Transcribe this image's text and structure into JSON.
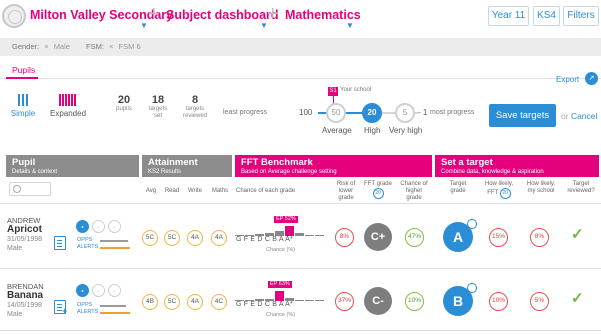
{
  "breadcrumb": [
    {
      "label": "Milton Valley Secondary"
    },
    {
      "label": "Subject dashboard"
    },
    {
      "label": "Mathematics"
    }
  ],
  "top_buttons": [
    "Year 11",
    "KS4",
    "Filters"
  ],
  "filters": [
    {
      "label": "Gender:",
      "value": "Male"
    },
    {
      "label": "FSM:",
      "value": "FSM 6"
    }
  ],
  "tabs": [
    {
      "label": "Pupils"
    }
  ],
  "export_label": "Export",
  "view_options": [
    {
      "label": "Simple",
      "active": true
    },
    {
      "label": "Expanded",
      "active": false
    }
  ],
  "stats": [
    {
      "value": "20",
      "label": "pupils"
    },
    {
      "value": "18",
      "label": "targets set"
    },
    {
      "value": "8",
      "label": "targets reviewed"
    }
  ],
  "slider": {
    "least_label": "least progress",
    "most_label": "most progress",
    "school_badge": "S1",
    "school_label": "Your school",
    "stops": [
      {
        "value": "50",
        "label": "Average",
        "active": false
      },
      {
        "value": "20",
        "label": "High",
        "active": true
      },
      {
        "value": "5",
        "label": "Very high",
        "active": false
      }
    ],
    "scale_min": "100",
    "scale_max": "1",
    "position_fraction": 0.55
  },
  "save_label": "Save targets",
  "or_label": "or",
  "cancel_label": "Cancel",
  "headers": {
    "pupil": {
      "title": "Pupil",
      "sub": "Details & context"
    },
    "attainment": {
      "title": "Attainment",
      "sub": "KS2 Results"
    },
    "fft": {
      "title": "FFT Benchmark",
      "sub": "Based on Average challenge setting"
    },
    "target": {
      "title": "Set a target",
      "sub": "Combine data, knowledge & aspiration"
    }
  },
  "subheaders": {
    "avg": "Avg",
    "read": "Read",
    "write": "Write",
    "maths": "Maths",
    "chance": "Chance of each grade",
    "risk": "Risk of lower grade",
    "fft_grade": "FFT grade",
    "fft_badge": "20",
    "chance_higher": "Chance of higher grade",
    "target_grade": "Target grade",
    "likely_fft": "How likely, FFT",
    "likely_school": "How likely, my school",
    "reviewed": "Target reviewed?"
  },
  "grade_scale": "G  F  E  D  C  B  A  A*",
  "chance_axis_label": "Chance (%)",
  "rows": [
    {
      "first": "ANDREW",
      "last": "Apricot",
      "dob": "31/05/1998",
      "gender": "Male",
      "opps": "OPPS",
      "alerts": "ALERTS",
      "ks2": [
        "5C",
        "5C",
        "4A",
        "4A"
      ],
      "flag": "EP 52%",
      "grade_chances": [
        4,
        7,
        12,
        18,
        24,
        52,
        15,
        5,
        2
      ],
      "highlight_index": 5,
      "risk": "8%",
      "fft_grade": "C+",
      "higher": "47%",
      "target": "A",
      "likely_fft": "15%",
      "likely_school": "8%"
    },
    {
      "first": "BRENDAN",
      "last": "Banana",
      "dob": "14/05/1998",
      "gender": "Male",
      "opps": "OPPS",
      "alerts": "ALERTS",
      "ks2": [
        "4B",
        "5C",
        "4A",
        "4C"
      ],
      "flag": "EP 63%",
      "grade_chances": [
        3,
        6,
        10,
        15,
        63,
        20,
        8,
        3,
        1
      ],
      "highlight_index": 4,
      "risk": "37%",
      "fft_grade": "C-",
      "higher": "10%",
      "target": "B",
      "likely_fft": "10%",
      "likely_school": "5%"
    }
  ]
}
